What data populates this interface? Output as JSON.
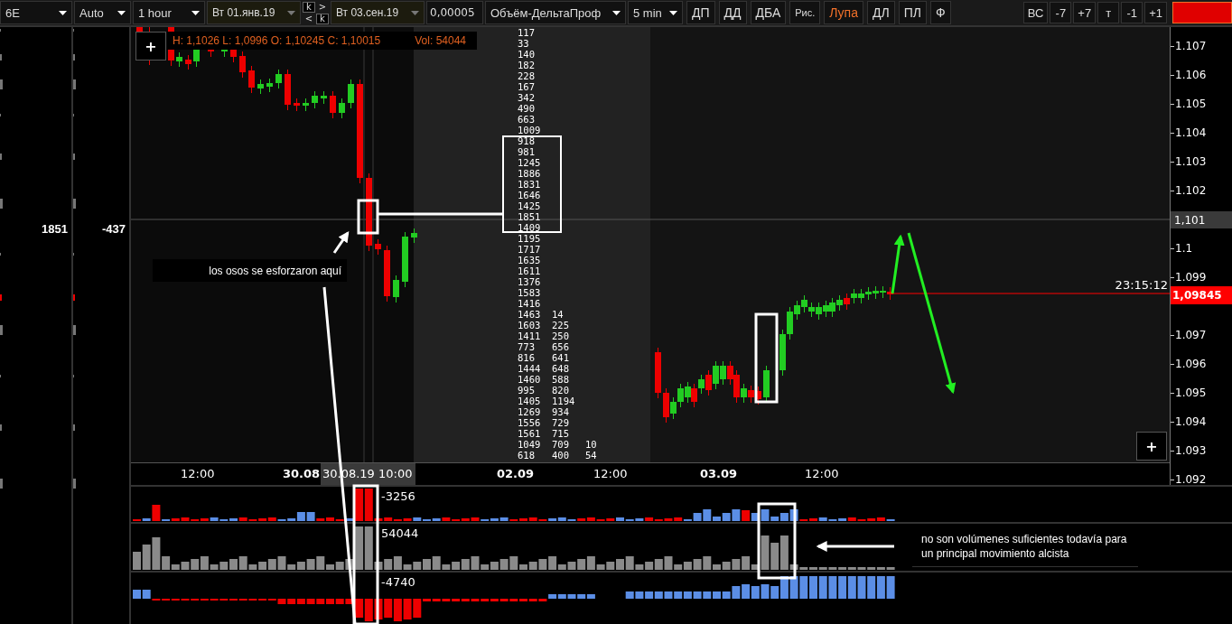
{
  "toolbar": {
    "left": [
      {
        "kind": "dropdown",
        "label": "6E"
      },
      {
        "kind": "dropdown",
        "label": "Auto"
      },
      {
        "kind": "dropdown",
        "label": "1 hour"
      },
      {
        "kind": "date",
        "label": "Вт 01.янв.19"
      },
      {
        "kind": "stepper",
        "keys": [
          {
            "kind": "key",
            "label": "k"
          },
          {
            "kind": "arrow",
            "label": ">"
          },
          {
            "kind": "arrow",
            "label": "<"
          },
          {
            "kind": "key",
            "label": "k"
          }
        ]
      },
      {
        "kind": "date",
        "label": "Вт 03.сен.19"
      },
      {
        "kind": "field",
        "value": "0,00005"
      },
      {
        "kind": "dropdown",
        "label": "Объём-ДельтаПроф"
      },
      {
        "kind": "dropdown",
        "label": "5 min"
      }
    ],
    "buttons": [
      {
        "label": "ДП",
        "active": false
      },
      {
        "label": "ДД",
        "active": false
      },
      {
        "label": "ДБА",
        "active": false
      },
      {
        "label": "Рис.",
        "active": false
      },
      {
        "label": "Лупа",
        "active": true
      },
      {
        "label": "ДЛ",
        "active": false
      },
      {
        "label": "ПЛ",
        "active": false
      },
      {
        "label": "Ф",
        "active": false
      }
    ],
    "right_buttons": [
      {
        "label": "ВС"
      },
      {
        "label": "-7"
      },
      {
        "label": "+7"
      },
      {
        "label": "т"
      },
      {
        "label": "-1"
      },
      {
        "label": "+1"
      }
    ]
  },
  "left_panel": {
    "values": [
      "1851",
      "-437"
    ]
  },
  "zoom_buttons": [
    "+",
    "+"
  ],
  "chart": {
    "ohlc": "H: 1,1026 L: 1,0996 O: 1,10245 C: 1,10015",
    "volume": "Vol: 54044",
    "clock": "23:15:12",
    "cluster_rows": [
      [
        "117"
      ],
      [
        "33"
      ],
      [
        "140"
      ],
      [
        "182"
      ],
      [
        "228"
      ],
      [
        "167"
      ],
      [
        "342"
      ],
      [
        "490"
      ],
      [
        "663"
      ],
      [
        "1009"
      ],
      [
        "918"
      ],
      [
        "981"
      ],
      [
        "1245"
      ],
      [
        "1886"
      ],
      [
        "1831"
      ],
      [
        "1646"
      ],
      [
        "1425"
      ],
      [
        "1851"
      ],
      [
        "1409"
      ],
      [
        "1195"
      ],
      [
        "1717"
      ],
      [
        "1635"
      ],
      [
        "1611"
      ],
      [
        "1376"
      ],
      [
        "1583"
      ],
      [
        "1416"
      ],
      [
        "1463",
        "14"
      ],
      [
        "1603",
        "225"
      ],
      [
        "1411",
        "250"
      ],
      [
        "773",
        "656"
      ],
      [
        "816",
        "641"
      ],
      [
        "1444",
        "648"
      ],
      [
        "1460",
        "588"
      ],
      [
        "995",
        "820"
      ],
      [
        "1405",
        "1194"
      ],
      [
        "1269",
        "934"
      ],
      [
        "1556",
        "729"
      ],
      [
        "1561",
        "715"
      ],
      [
        "1049",
        "709",
        "10"
      ],
      [
        "618",
        "400",
        "54"
      ]
    ]
  },
  "price_axis": [
    {
      "kind": "tick",
      "label": "1.107"
    },
    {
      "kind": "tick",
      "label": "1.106"
    },
    {
      "kind": "tick",
      "label": "1.105"
    },
    {
      "kind": "tick",
      "label": "1.104"
    },
    {
      "kind": "tick",
      "label": "1.103"
    },
    {
      "kind": "tick",
      "label": "1.102"
    },
    {
      "kind": "cursor",
      "label": "1,101"
    },
    {
      "kind": "tick",
      "label": "1.1"
    },
    {
      "kind": "tick",
      "label": "1.099"
    },
    {
      "kind": "last",
      "label": "1,09845"
    },
    {
      "kind": "tick",
      "label": "1.097"
    },
    {
      "kind": "tick",
      "label": "1.096"
    },
    {
      "kind": "tick",
      "label": "1.095"
    },
    {
      "kind": "tick",
      "label": "1.094"
    },
    {
      "kind": "tick",
      "label": "1.093"
    },
    {
      "kind": "tick",
      "label": "1.092"
    }
  ],
  "time_axis": [
    {
      "kind": "time",
      "label": "12:00"
    },
    {
      "kind": "date",
      "label": "30.08"
    },
    {
      "kind": "cursor",
      "label": "30.08.19 10:00"
    },
    {
      "kind": "date",
      "label": "02.09"
    },
    {
      "kind": "time",
      "label": "12:00"
    },
    {
      "kind": "date",
      "label": "03.09"
    },
    {
      "kind": "time",
      "label": "12:00"
    }
  ],
  "indicators": [
    {
      "kind": "delta",
      "label": "-3256"
    },
    {
      "kind": "volume",
      "label": "54044"
    },
    {
      "kind": "cumulative",
      "label": "-4740"
    }
  ],
  "annotations": [
    {
      "text": "los osos se esforzaron aquí"
    },
    {
      "text": "no son volúmenes suficientes todavía para un principal movimiento alcista"
    }
  ]
}
